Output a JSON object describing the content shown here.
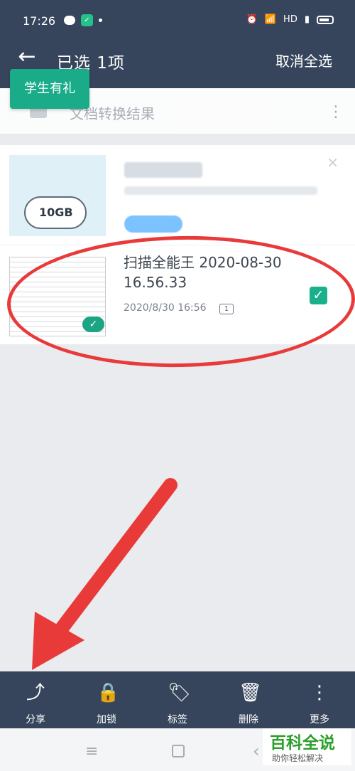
{
  "status_bar": {
    "time": "17:26",
    "network": "HD"
  },
  "app_bar": {
    "title": "已选 1项",
    "cancel_select": "取消全选",
    "back_icon": "arrow-left-icon"
  },
  "promo": {
    "label": "学生有礼"
  },
  "convert_row": {
    "label": "文档转换结果"
  },
  "ad": {
    "cloud_label": "10GB",
    "close_icon": "close-icon"
  },
  "document": {
    "title": "扫描全能王 2020-08-30 16.56.33",
    "date": "2020/8/30 16:56",
    "pages": "1",
    "checked": true
  },
  "toolbar": {
    "items": [
      {
        "label": "分享",
        "icon": "share-icon"
      },
      {
        "label": "加锁",
        "icon": "lock-icon"
      },
      {
        "label": "标签",
        "icon": "tag-icon"
      },
      {
        "label": "删除",
        "icon": "trash-icon"
      },
      {
        "label": "更多",
        "icon": "more-vertical-icon"
      }
    ]
  },
  "watermark": {
    "main": "百科全说",
    "sub": "助你轻松解决"
  },
  "colors": {
    "header": "#36455b",
    "accent": "#19b08b",
    "annotation": "#e93a3a"
  }
}
